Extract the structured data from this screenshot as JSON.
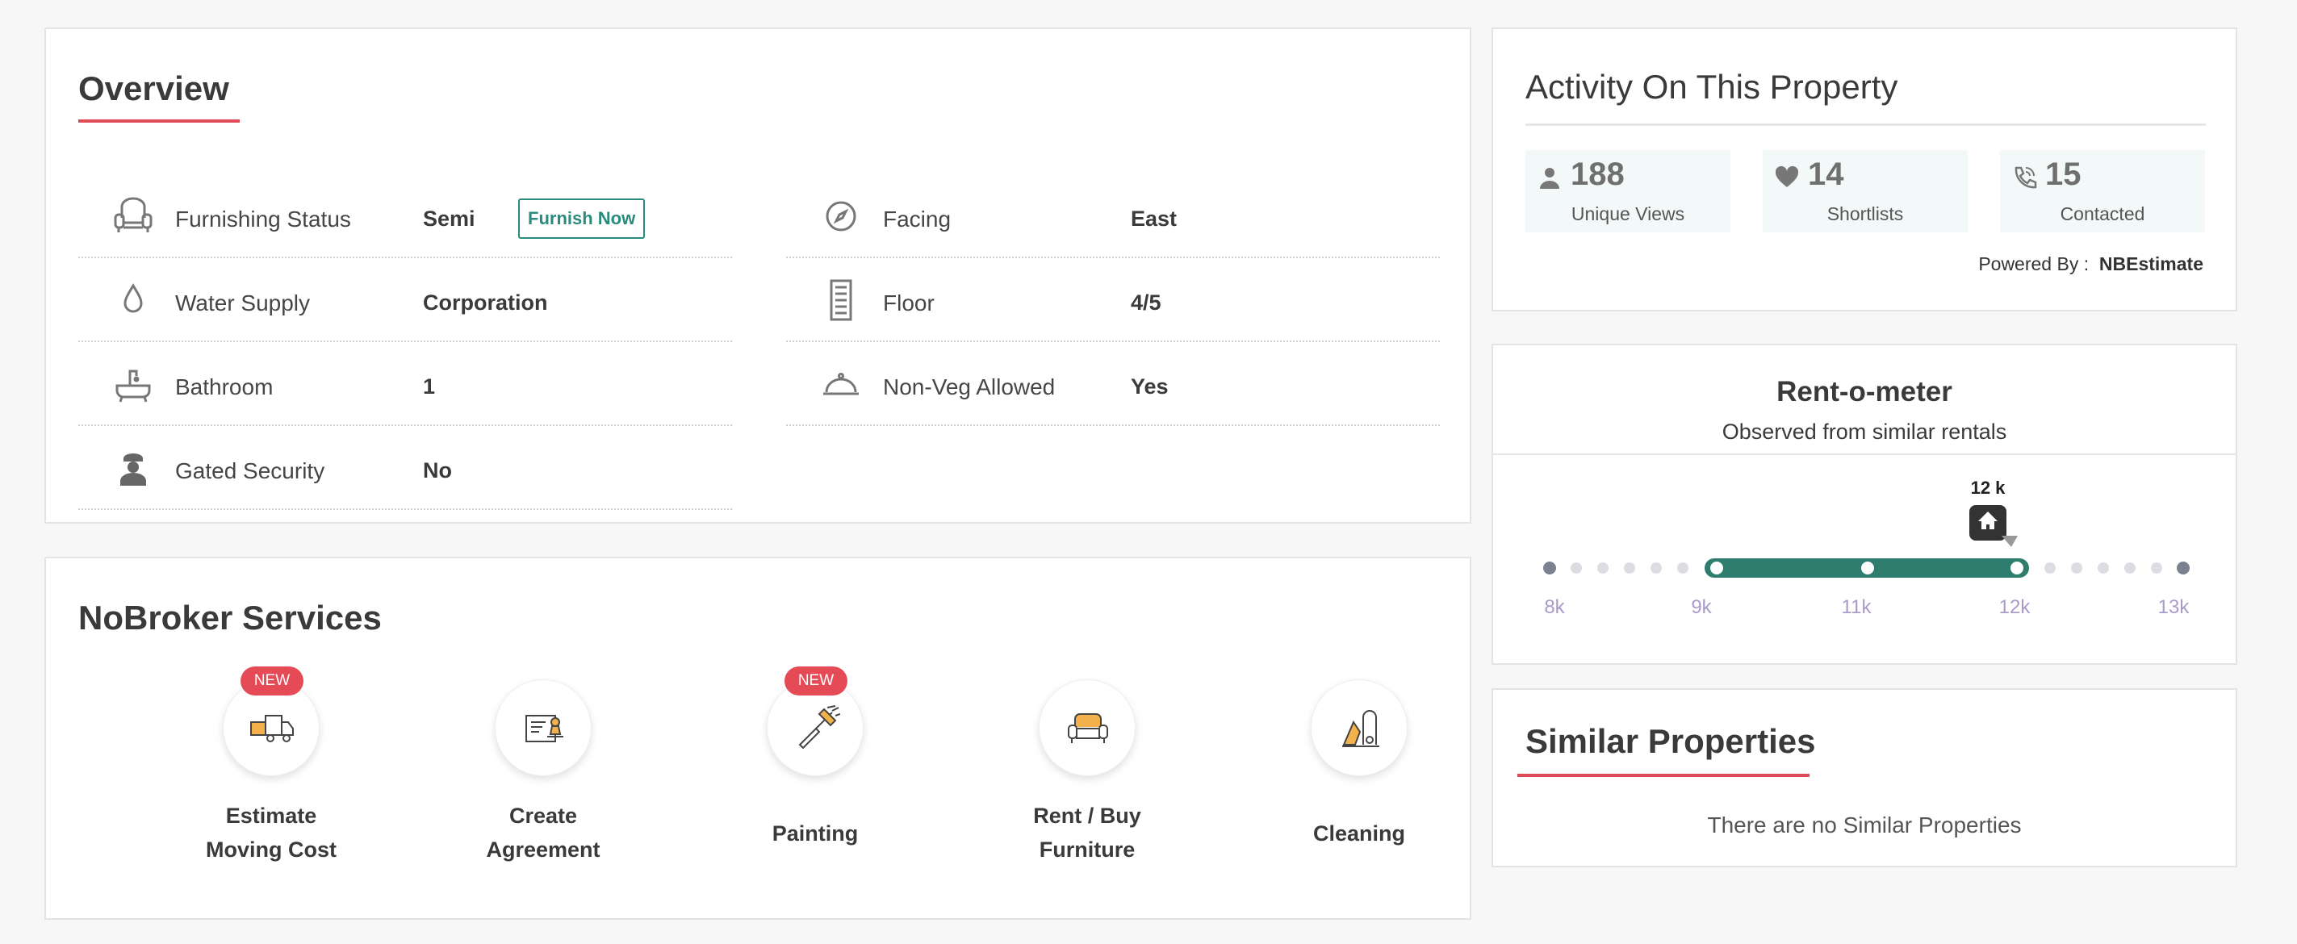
{
  "overview": {
    "title": "Overview",
    "furnish_now": "Furnish Now",
    "left": [
      {
        "label": "Furnishing Status",
        "value": "Semi",
        "icon": "armchair-icon"
      },
      {
        "label": "Water Supply",
        "value": "Corporation",
        "icon": "water-drop-icon"
      },
      {
        "label": "Bathroom",
        "value": "1",
        "icon": "bathtub-icon"
      },
      {
        "label": "Gated Security",
        "value": "No",
        "icon": "security-guard-icon"
      }
    ],
    "right": [
      {
        "label": "Facing",
        "value": "East",
        "icon": "compass-icon"
      },
      {
        "label": "Floor",
        "value": "4/5",
        "icon": "building-icon"
      },
      {
        "label": "Non-Veg Allowed",
        "value": "Yes",
        "icon": "food-cloche-icon"
      }
    ]
  },
  "services": {
    "title": "NoBroker Services",
    "items": [
      {
        "line1": "Estimate",
        "line2": "Moving Cost",
        "badge": "NEW",
        "icon": "moving-truck-icon"
      },
      {
        "line1": "Create",
        "line2": "Agreement",
        "badge": "",
        "icon": "stamp-document-icon"
      },
      {
        "line1": "Painting",
        "line2": "",
        "badge": "NEW",
        "icon": "paint-brush-icon"
      },
      {
        "line1": "Rent / Buy",
        "line2": "Furniture",
        "badge": "",
        "icon": "sofa-icon"
      },
      {
        "line1": "Cleaning",
        "line2": "",
        "badge": "",
        "icon": "vacuum-cleaner-icon"
      }
    ]
  },
  "activity": {
    "title": "Activity On This Property",
    "stats": [
      {
        "value": "188",
        "caption": "Unique Views",
        "icon": "person-icon"
      },
      {
        "value": "14",
        "caption": "Shortlists",
        "icon": "heart-icon"
      },
      {
        "value": "15",
        "caption": "Contacted",
        "icon": "phone-icon"
      }
    ],
    "powered_label": "Powered By :",
    "powered_name": "NBEstimate"
  },
  "rentometer": {
    "title": "Rent-o-meter",
    "subtitle": "Observed from similar rentals",
    "marker_label": "12 k",
    "ticks": [
      "8k",
      "9k",
      "11k",
      "12k",
      "13k"
    ],
    "accent": "#2e7d6f"
  },
  "similar": {
    "title": "Similar Properties",
    "empty_text": "There are no Similar Properties"
  }
}
